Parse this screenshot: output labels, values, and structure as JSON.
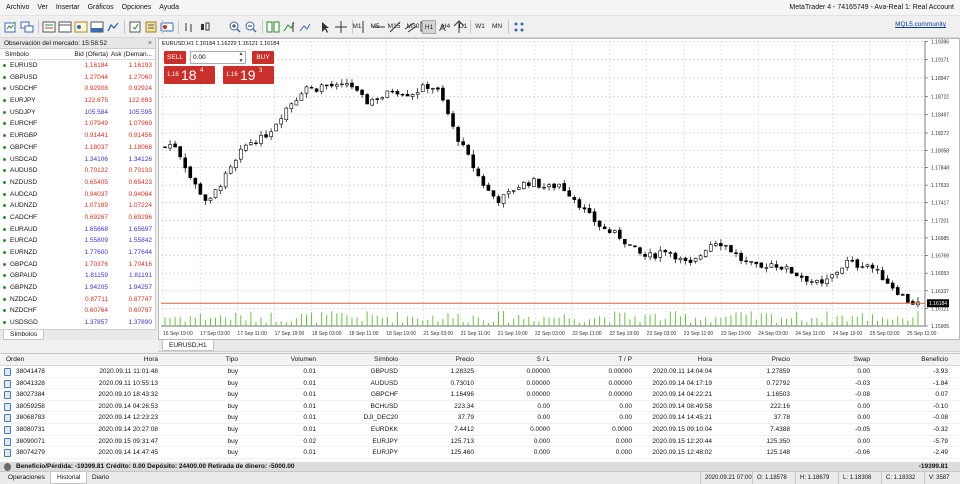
{
  "menu": [
    "Archivo",
    "Ver",
    "Insertar",
    "Gráficos",
    "Opciones",
    "Ayuda"
  ],
  "window_title": "MetaTrader 4 - 74165749 - Ava-Real 1: Real Account",
  "toolbar": {
    "timeframes": [
      "M1",
      "M5",
      "M15",
      "M30",
      "H1",
      "H4",
      "D1",
      "W1",
      "MN"
    ],
    "active_timeframe": "H1",
    "mql5_link": "MQL5.community"
  },
  "market_watch": {
    "title": "Observación del mercado: 15:58:52",
    "close": "×",
    "headers": {
      "symbol": "Símbolo",
      "bid": "Bid (Oferta)",
      "ask": "Ask (Deman..."
    },
    "rows": [
      {
        "symbol": "EURUSD",
        "bid": "1.16184",
        "ask": "1.16193",
        "color": "#d9301f",
        "dot": "#2e8b2e"
      },
      {
        "symbol": "GBPUSD",
        "bid": "1.27044",
        "ask": "1.27060",
        "color": "#d9301f",
        "dot": "#2e8b2e"
      },
      {
        "symbol": "USDCHF",
        "bid": "0.92908",
        "ask": "0.92924",
        "color": "#d9301f",
        "dot": "#2e8b2e"
      },
      {
        "symbol": "EURJPY",
        "bid": "122.675",
        "ask": "122.693",
        "color": "#d9301f",
        "dot": "#2e8b2e"
      },
      {
        "symbol": "USDJPY",
        "bid": "105.584",
        "ask": "105.595",
        "color": "#3a36c8",
        "dot": "#2e8b2e"
      },
      {
        "symbol": "EURCHF",
        "bid": "1.07949",
        "ask": "1.07969",
        "color": "#d9301f",
        "dot": "#2e8b2e"
      },
      {
        "symbol": "EURGBP",
        "bid": "0.91441",
        "ask": "0.91456",
        "color": "#d9301f",
        "dot": "#2e8b2e"
      },
      {
        "symbol": "GBPCHF",
        "bid": "1.18037",
        "ask": "1.18068",
        "color": "#d9301f",
        "dot": "#2e8b2e"
      },
      {
        "symbol": "USDCAD",
        "bid": "1.34106",
        "ask": "1.34126",
        "color": "#3a36c8",
        "dot": "#2e8b2e"
      },
      {
        "symbol": "AUDUSD",
        "bid": "0.70122",
        "ask": "0.70133",
        "color": "#d9301f",
        "dot": "#2e8b2e"
      },
      {
        "symbol": "NZDUSD",
        "bid": "0.65405",
        "ask": "0.65423",
        "color": "#d9301f",
        "dot": "#2e8b2e"
      },
      {
        "symbol": "AUDCAD",
        "bid": "0.94037",
        "ask": "0.94064",
        "color": "#d9301f",
        "dot": "#2e8b2e"
      },
      {
        "symbol": "AUDNZD",
        "bid": "1.07189",
        "ask": "1.07224",
        "color": "#d9301f",
        "dot": "#2e8b2e"
      },
      {
        "symbol": "CADCHF",
        "bid": "0.69267",
        "ask": "0.69296",
        "color": "#d9301f",
        "dot": "#2e8b2e"
      },
      {
        "symbol": "EURAUD",
        "bid": "1.65668",
        "ask": "1.65697",
        "color": "#3a36c8",
        "dot": "#2e8b2e"
      },
      {
        "symbol": "EURCAD",
        "bid": "1.55809",
        "ask": "1.55842",
        "color": "#3a36c8",
        "dot": "#2e8b2e"
      },
      {
        "symbol": "EURNZD",
        "bid": "1.77600",
        "ask": "1.77644",
        "color": "#3a36c8",
        "dot": "#2e8b2e"
      },
      {
        "symbol": "GBPCAD",
        "bid": "1.70376",
        "ask": "1.70416",
        "color": "#d9301f",
        "dot": "#2e8b2e"
      },
      {
        "symbol": "GBPAUD",
        "bid": "1.81159",
        "ask": "1.81191",
        "color": "#3a36c8",
        "dot": "#2e8b2e"
      },
      {
        "symbol": "GBPNZD",
        "bid": "1.94205",
        "ask": "1.94257",
        "color": "#3a36c8",
        "dot": "#2e8b2e"
      },
      {
        "symbol": "NZDCAD",
        "bid": "0.87711",
        "ask": "0.87747",
        "color": "#d9301f",
        "dot": "#2e8b2e"
      },
      {
        "symbol": "NZDCHF",
        "bid": "0.60764",
        "ask": "0.60797",
        "color": "#d9301f",
        "dot": "#2e8b2e"
      },
      {
        "symbol": "USDSGD",
        "bid": "1.37857",
        "ask": "1.37890",
        "color": "#3a36c8",
        "dot": "#2e8b2e"
      }
    ],
    "tab": "Símbolos"
  },
  "chart": {
    "symbol_info": "EURUSD,H1  1.16184 1.16229 1.16121 1.16184",
    "tab": "EURUSD,H1",
    "trade_panel": {
      "sell_label": "SELL",
      "buy_label": "BUY",
      "lot": "0.00",
      "sell_price": {
        "prefix": "1.16",
        "big": "18",
        "sup": "4"
      },
      "buy_price": {
        "prefix": "1.16",
        "big": "19",
        "sup": "3"
      }
    },
    "current_price": "1.16184",
    "current_price_value": 1.16184
  },
  "chart_data": {
    "type": "candlestick",
    "symbol": "EURUSD",
    "timeframe": "H1",
    "ylim": [
      1.15905,
      1.194
    ],
    "y_ticks": [
      "1.19396",
      "1.19171",
      "1.18947",
      "1.18722",
      "1.18497",
      "1.18272",
      "1.18058",
      "1.17848",
      "1.17633",
      "1.17417",
      "1.17201",
      "1.16985",
      "1.16769",
      "1.16553",
      "1.16337",
      "1.16121",
      "1.15905"
    ],
    "x_ticks": [
      "16 Sep 19:00",
      "17 Sep 03:00",
      "17 Sep 11:00",
      "17 Sep 19:00",
      "18 Sep 03:00",
      "18 Sep 11:00",
      "18 Sep 19:00",
      "21 Sep 03:00",
      "21 Sep 11:00",
      "21 Sep 19:00",
      "22 Sep 03:00",
      "22 Sep 11:00",
      "22 Sep 19:00",
      "23 Sep 03:00",
      "23 Sep 11:00",
      "23 Sep 19:00",
      "24 Sep 03:00",
      "24 Sep 11:00",
      "24 Sep 19:00",
      "25 Sep 03:00",
      "25 Sep 11:00"
    ],
    "close_path": [
      1.181,
      1.1815,
      1.1795,
      1.177,
      1.1755,
      1.174,
      1.176,
      1.1775,
      1.179,
      1.181,
      1.1818,
      1.182,
      1.183,
      1.1845,
      1.186,
      1.187,
      1.1885,
      1.188,
      1.1886,
      1.1885,
      1.1882,
      1.189,
      1.1875,
      1.1865,
      1.187,
      1.1872,
      1.188,
      1.1878,
      1.1875,
      1.188,
      1.1885,
      1.1882,
      1.186,
      1.183,
      1.181,
      1.179,
      1.177,
      1.1755,
      1.1745,
      1.175,
      1.176,
      1.1765,
      1.1768,
      1.1762,
      1.176,
      1.1765,
      1.1755,
      1.1745,
      1.173,
      1.172,
      1.171,
      1.1705,
      1.17,
      1.169,
      1.168,
      1.1675,
      1.1678,
      1.1685,
      1.168,
      1.167,
      1.1665,
      1.1675,
      1.169,
      1.1695,
      1.169,
      1.168,
      1.167,
      1.1665,
      1.166,
      1.1668,
      1.1665,
      1.166,
      1.1655,
      1.165,
      1.1645,
      1.164,
      1.165,
      1.166,
      1.167,
      1.1665,
      1.1668,
      1.166,
      1.165,
      1.164,
      1.163,
      1.162,
      1.1618
    ],
    "last_price": 1.16184
  },
  "terminal": {
    "headers": [
      "Orden",
      "Hora",
      "Tipo",
      "Volumen",
      "Símbolo",
      "Precio",
      "S / L",
      "T / P",
      "Hora",
      "Precio",
      "Swap",
      "Beneficio"
    ],
    "rows": [
      [
        "38041478",
        "2020.09.11 11:01:48",
        "buy",
        "0.01",
        "GBPUSD",
        "1.28325",
        "0.00000",
        "0.00000",
        "2020.09.11 14:04:04",
        "1.27859",
        "0.00",
        "-3.93"
      ],
      [
        "38041328",
        "2020.09.11 10:55:13",
        "buy",
        "0.01",
        "AUDUSD",
        "0.73010",
        "0.00000",
        "0.00000",
        "2020.09.14 04:17:19",
        "0.72792",
        "-0.03",
        "-1.84"
      ],
      [
        "38027384",
        "2020.09.10 18:43:32",
        "buy",
        "0.01",
        "GBPCHF",
        "1.16496",
        "0.00000",
        "0.00000",
        "2020.09.14 04:22:21",
        "1.16503",
        "-0.08",
        "0.07"
      ],
      [
        "38059258",
        "2020.09.14 04:26:53",
        "buy",
        "0.01",
        "BCHUSD",
        "223.34",
        "0.00",
        "0.00",
        "2020.09.14 08:49:58",
        "222.16",
        "0.00",
        "-0.10"
      ],
      [
        "38068783",
        "2020.09.14 12:23:23",
        "buy",
        "0.01",
        "DJI_DEC20",
        "37.79",
        "0.00",
        "0.00",
        "2020.09.14 14:45:21",
        "37.78",
        "0.00",
        "-0.08"
      ],
      [
        "38080731",
        "2020.09.14 20:27:08",
        "buy",
        "0.01",
        "EURDKK",
        "7.4412",
        "0.0000",
        "0.0000",
        "2020.09.15 09:10:04",
        "7.4388",
        "-0.05",
        "-0.32"
      ],
      [
        "38090071",
        "2020.09.15 09:31:47",
        "buy",
        "0.02",
        "EURJPY",
        "125.713",
        "0.000",
        "0.000",
        "2020.09.15 12:20:44",
        "125.350",
        "0.00",
        "-5.79"
      ],
      [
        "38074279",
        "2020.09.14 14:47:45",
        "buy",
        "0.01",
        "EURJPY",
        "125.460",
        "0.000",
        "0.000",
        "2020.09.15 12:48:02",
        "125.148",
        "-0.06",
        "-2.49"
      ]
    ],
    "summary": "Beneficio/Pérdida: -19399.81  Crédito: 0.00  Depósito: 24400.00  Retirada de dinero: -5000.00",
    "total": "-19399.81"
  },
  "bottom_tabs": [
    "Operaciones",
    "Historial",
    "Diario"
  ],
  "active_bottom_tab": "Historial",
  "status": {
    "time": "2020.09.21 07:00",
    "open": "O: 1.18578",
    "high": "H: 1.18679",
    "low": "L: 1.18308",
    "close": "C: 1.18332",
    "volume": "V: 3587"
  },
  "colors": {
    "sell_button": "#c9302c",
    "price_line": "#d9643a",
    "bull": "#ffffff",
    "bear": "#000000",
    "volume": "#6fbf4b"
  }
}
